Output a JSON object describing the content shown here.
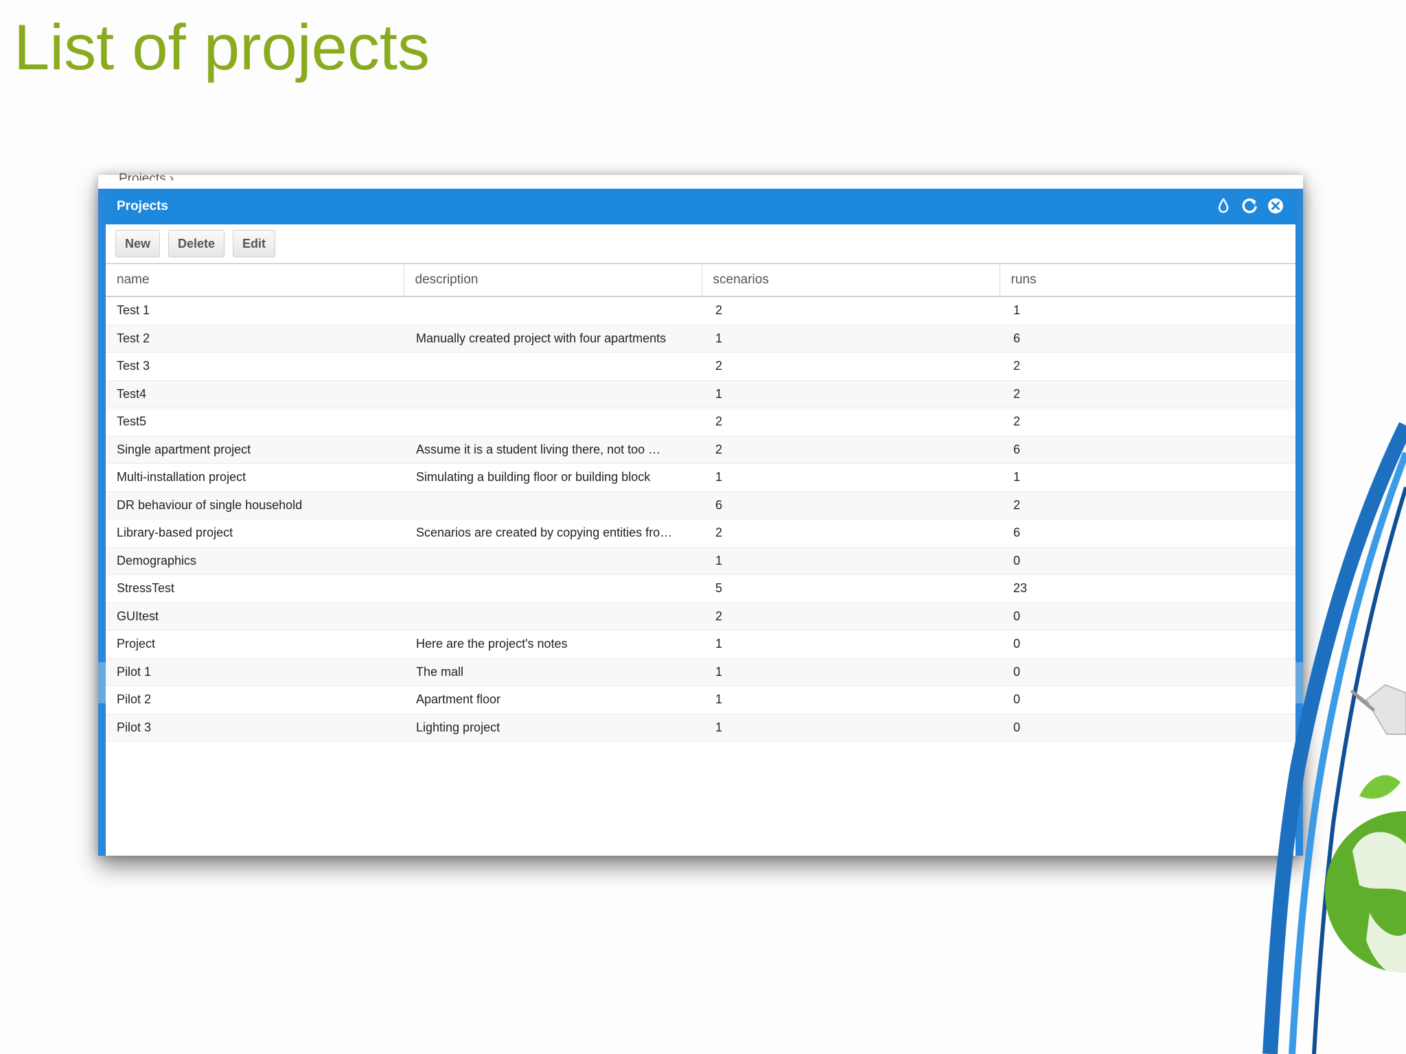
{
  "slide": {
    "title": "List of projects"
  },
  "window": {
    "breadcrumb": "Projects ›",
    "panel_title": "Projects",
    "header_icons": [
      "drop-icon",
      "refresh-icon",
      "close-icon"
    ]
  },
  "toolbar": {
    "new_label": "New",
    "delete_label": "Delete",
    "edit_label": "Edit"
  },
  "table": {
    "columns": [
      "name",
      "description",
      "scenarios",
      "runs"
    ],
    "rows": [
      {
        "name": "Test 1",
        "description": "",
        "scenarios": "2",
        "runs": "1"
      },
      {
        "name": "Test 2",
        "description": "Manually created project with four apartments",
        "scenarios": "1",
        "runs": "6"
      },
      {
        "name": "Test 3",
        "description": "",
        "scenarios": "2",
        "runs": "2"
      },
      {
        "name": "Test4",
        "description": "",
        "scenarios": "1",
        "runs": "2"
      },
      {
        "name": "Test5",
        "description": "",
        "scenarios": "2",
        "runs": "2"
      },
      {
        "name": "Single apartment project",
        "description": "Assume it is a student living there, not too …",
        "scenarios": "2",
        "runs": "6"
      },
      {
        "name": "Multi-installation project",
        "description": "Simulating a building floor or building block",
        "scenarios": "1",
        "runs": "1"
      },
      {
        "name": "DR behaviour of single household",
        "description": "",
        "scenarios": "6",
        "runs": "2"
      },
      {
        "name": "Library-based project",
        "description": "Scenarios are created by copying entities fro…",
        "scenarios": "2",
        "runs": "6"
      },
      {
        "name": "Demographics",
        "description": "",
        "scenarios": "1",
        "runs": "0"
      },
      {
        "name": "StressTest",
        "description": "",
        "scenarios": "5",
        "runs": "23"
      },
      {
        "name": "GUItest",
        "description": "",
        "scenarios": "2",
        "runs": "0"
      },
      {
        "name": "Project",
        "description": "Here are the project's notes",
        "scenarios": "1",
        "runs": "0"
      },
      {
        "name": "Pilot 1",
        "description": "The mall",
        "scenarios": "1",
        "runs": "0"
      },
      {
        "name": "Pilot 2",
        "description": "Apartment floor",
        "scenarios": "1",
        "runs": "0"
      },
      {
        "name": "Pilot 3",
        "description": "Lighting project",
        "scenarios": "1",
        "runs": "0"
      }
    ]
  },
  "colors": {
    "title_green": "#8aab1e",
    "header_blue": "#1e88dc",
    "frame_blue": "#2a86d8"
  }
}
